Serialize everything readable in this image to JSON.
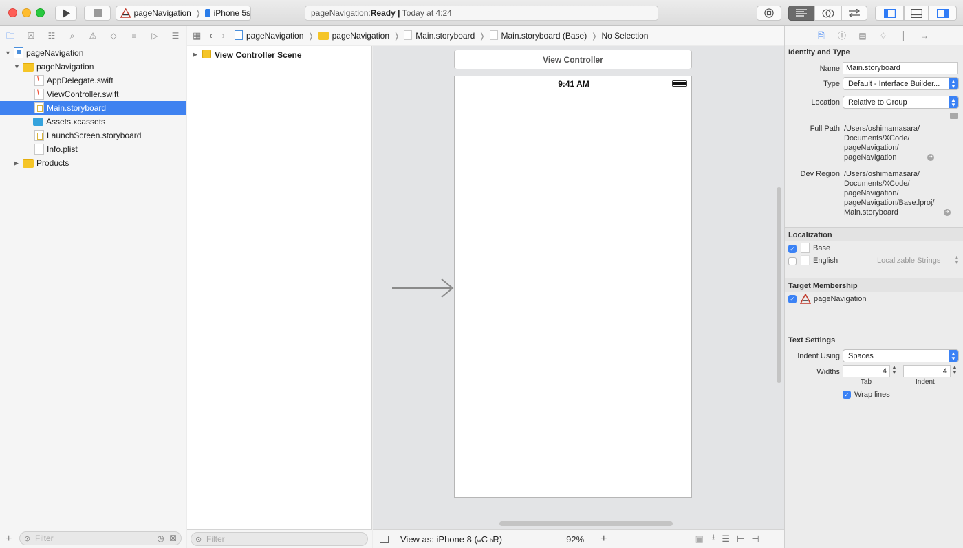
{
  "toolbar": {
    "scheme_project": "pageNavigation",
    "scheme_device": "iPhone 5s",
    "status_project": "pageNavigation: ",
    "status_state": "Ready",
    "status_sep": " | ",
    "status_time": "Today at 4:24",
    "run_icon": "play-icon",
    "stop_icon": "stop-icon"
  },
  "navigator": {
    "tree": [
      {
        "label": "pageNavigation",
        "icon": "project"
      },
      {
        "label": "pageNavigation",
        "icon": "folder"
      },
      {
        "label": "AppDelegate.swift",
        "icon": "swift"
      },
      {
        "label": "ViewController.swift",
        "icon": "swift"
      },
      {
        "label": "Main.storyboard",
        "icon": "storyboard",
        "selected": true
      },
      {
        "label": "Assets.xcassets",
        "icon": "assets"
      },
      {
        "label": "LaunchScreen.storyboard",
        "icon": "storyboard"
      },
      {
        "label": "Info.plist",
        "icon": "plist"
      },
      {
        "label": "Products",
        "icon": "folder"
      }
    ],
    "filter_placeholder": "Filter"
  },
  "jumpbar": {
    "crumbs": [
      "pageNavigation",
      "pageNavigation",
      "Main.storyboard",
      "Main.storyboard (Base)",
      "No Selection"
    ]
  },
  "outline": {
    "scene": "View Controller Scene",
    "filter_placeholder": "Filter"
  },
  "canvas": {
    "vc_title": "View Controller",
    "time": "9:41 AM",
    "view_as_prefix": "View as: iPhone 8 (",
    "size_class_w": "w",
    "size_class_c": "C",
    "size_class_h": "h",
    "size_class_r": "R)",
    "zoom_minus": "—",
    "zoom": "92%",
    "zoom_plus": "+"
  },
  "inspector": {
    "identity_title": "Identity and Type",
    "name_label": "Name",
    "name_value": "Main.storyboard",
    "type_label": "Type",
    "type_value": "Default - Interface Builder...",
    "location_label": "Location",
    "location_value": "Relative to Group",
    "fullpath_label": "Full Path",
    "fullpath_lines": [
      "/Users/oshimamasara/",
      "Documents/XCode/",
      "pageNavigation/",
      "pageNavigation"
    ],
    "devregion_label": "Dev Region",
    "devregion_lines": [
      "/Users/oshimamasara/",
      "Documents/XCode/",
      "pageNavigation/",
      "pageNavigation/Base.lproj/",
      "Main.storyboard"
    ],
    "localization_title": "Localization",
    "loc_base": "Base",
    "loc_english": "English",
    "loc_english_type": "Localizable Strings",
    "target_title": "Target Membership",
    "target_name": "pageNavigation",
    "text_title": "Text Settings",
    "indent_label": "Indent Using",
    "indent_value": "Spaces",
    "widths_label": "Widths",
    "tab_value": "4",
    "indent_width_value": "4",
    "tab_caption": "Tab",
    "indent_caption": "Indent",
    "wrap_label": "Wrap lines"
  },
  "colors": {
    "accent": "#3b82f5",
    "selection": "#3f82f0",
    "folder": "#f5c527"
  }
}
